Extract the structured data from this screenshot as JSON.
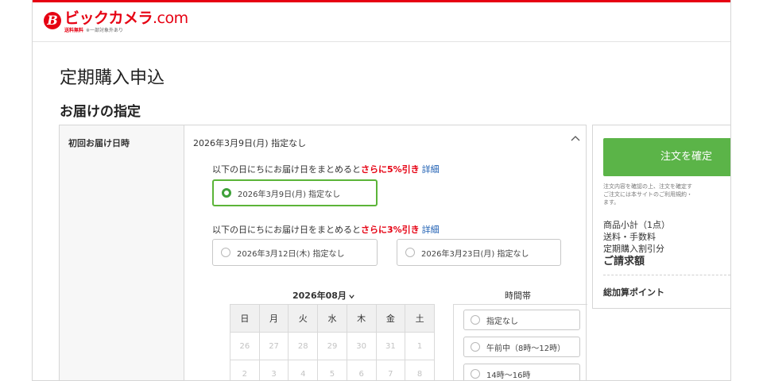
{
  "header": {
    "logo_name_red": "ビックカメラ",
    "logo_name_dot": ".com",
    "free_shipping": "送料無料",
    "shipping_note": "※一部対象外あり"
  },
  "page": {
    "title": "定期購入申込",
    "section": "お届けの指定"
  },
  "delivery": {
    "label": "初回お届け日時",
    "selected": "2026年3月9日(月)  指定なし",
    "promo1": {
      "prefix": "以下の日にちにお届け日をまとめると",
      "highlight": "さらに5%引き",
      "link": "詳細"
    },
    "option_selected": "2026年3月9日(月)  指定なし",
    "promo2": {
      "prefix": "以下の日にちにお届け日をまとめると",
      "highlight": "さらに3%引き",
      "link": "詳細"
    },
    "options": [
      "2026年3月12日(木)  指定なし",
      "2026年3月23日(月)  指定なし"
    ]
  },
  "calendar": {
    "month": "2026年08月",
    "weekdays": [
      "日",
      "月",
      "火",
      "水",
      "木",
      "金",
      "土"
    ],
    "rows": [
      [
        "26",
        "27",
        "28",
        "29",
        "30",
        "31",
        "1"
      ],
      [
        "2",
        "3",
        "4",
        "5",
        "6",
        "7",
        "8"
      ]
    ]
  },
  "timeslot": {
    "title": "時間帯",
    "slots": [
      "指定なし",
      "午前中（8時～12時）",
      "14時～16時"
    ]
  },
  "sidebar": {
    "confirm_label": "注文を確定",
    "notice": [
      "注文内容を確認の上、注文を確定す",
      "ご注文には本サイトのご利用規約・",
      "ます。"
    ],
    "subtotal": "商品小計（1点）",
    "shipping": "送料・手数料",
    "discount": "定期購入割引分",
    "total": "ご請求額",
    "points": "総加算ポイント"
  },
  "colors": {
    "brand": "#e60012",
    "accent_green": "#5bb448",
    "link": "#1e5fb3"
  }
}
